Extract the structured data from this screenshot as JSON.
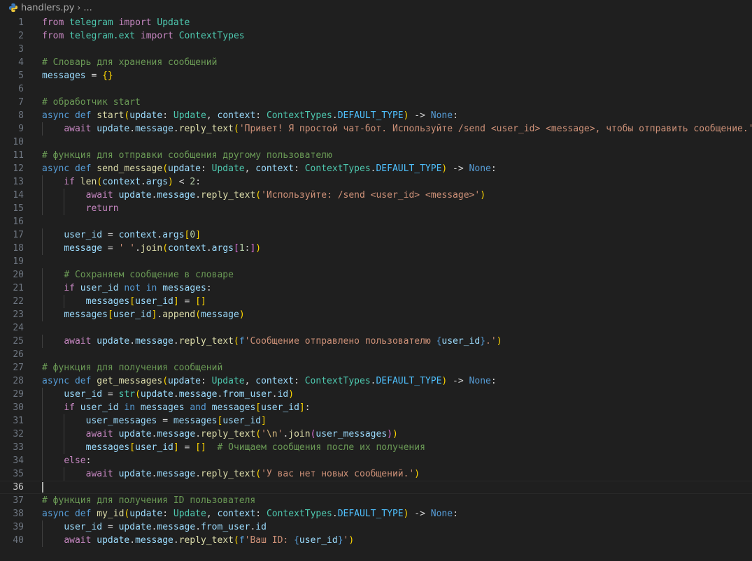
{
  "breadcrumb": {
    "file": "handlers.py",
    "more": "..."
  },
  "editor": {
    "current_line": 36,
    "lines": [
      {
        "n": "1"
      },
      {
        "n": "2"
      },
      {
        "n": "3"
      },
      {
        "n": "4"
      },
      {
        "n": "5"
      },
      {
        "n": "6"
      },
      {
        "n": "7"
      },
      {
        "n": "8"
      },
      {
        "n": "9"
      },
      {
        "n": "10"
      },
      {
        "n": "11"
      },
      {
        "n": "12"
      },
      {
        "n": "13"
      },
      {
        "n": "14"
      },
      {
        "n": "15"
      },
      {
        "n": "16"
      },
      {
        "n": "17"
      },
      {
        "n": "18"
      },
      {
        "n": "19"
      },
      {
        "n": "20"
      },
      {
        "n": "21"
      },
      {
        "n": "22"
      },
      {
        "n": "23"
      },
      {
        "n": "24"
      },
      {
        "n": "25"
      },
      {
        "n": "26"
      },
      {
        "n": "27"
      },
      {
        "n": "28"
      },
      {
        "n": "29"
      },
      {
        "n": "30"
      },
      {
        "n": "31"
      },
      {
        "n": "32"
      },
      {
        "n": "33"
      },
      {
        "n": "34"
      },
      {
        "n": "35"
      },
      {
        "n": "36"
      },
      {
        "n": "37"
      },
      {
        "n": "38"
      },
      {
        "n": "39"
      },
      {
        "n": "40"
      }
    ],
    "code": [
      [
        [
          "k",
          "from"
        ],
        [
          "o",
          " "
        ],
        [
          "t",
          "telegram"
        ],
        [
          "o",
          " "
        ],
        [
          "k",
          "import"
        ],
        [
          "o",
          " "
        ],
        [
          "t",
          "Update"
        ]
      ],
      [
        [
          "k",
          "from"
        ],
        [
          "o",
          " "
        ],
        [
          "t",
          "telegram.ext"
        ],
        [
          "o",
          " "
        ],
        [
          "k",
          "import"
        ],
        [
          "o",
          " "
        ],
        [
          "t",
          "ContextTypes"
        ]
      ],
      [],
      [
        [
          "c",
          "# Словарь для хранения сообщений"
        ]
      ],
      [
        [
          "v",
          "messages"
        ],
        [
          "o",
          " = "
        ],
        [
          "b1",
          "{}"
        ]
      ],
      [],
      [
        [
          "c",
          "# обработчик start"
        ]
      ],
      [
        [
          "d",
          "async"
        ],
        [
          "o",
          " "
        ],
        [
          "d",
          "def"
        ],
        [
          "o",
          " "
        ],
        [
          "f",
          "start"
        ],
        [
          "b1",
          "("
        ],
        [
          "v",
          "update"
        ],
        [
          "o",
          ": "
        ],
        [
          "t",
          "Update"
        ],
        [
          "o",
          ", "
        ],
        [
          "v",
          "context"
        ],
        [
          "o",
          ": "
        ],
        [
          "t",
          "ContextTypes"
        ],
        [
          "o",
          "."
        ],
        [
          "cst",
          "DEFAULT_TYPE"
        ],
        [
          "b1",
          ")"
        ],
        [
          "o",
          " -> "
        ],
        [
          "d",
          "None"
        ],
        [
          "o",
          ":"
        ]
      ],
      [
        [
          "o",
          "    "
        ],
        [
          "k",
          "await"
        ],
        [
          "o",
          " "
        ],
        [
          "v",
          "update"
        ],
        [
          "o",
          "."
        ],
        [
          "v",
          "message"
        ],
        [
          "o",
          "."
        ],
        [
          "f",
          "reply_text"
        ],
        [
          "b1",
          "("
        ],
        [
          "s",
          "'Привет! Я простой чат-бот. Используйте /send <user_id> <message>, чтобы отправить сообщение.'"
        ],
        [
          "b1",
          ")"
        ]
      ],
      [],
      [
        [
          "c",
          "# функция для отправки сообщения другому пользователю"
        ]
      ],
      [
        [
          "d",
          "async"
        ],
        [
          "o",
          " "
        ],
        [
          "d",
          "def"
        ],
        [
          "o",
          " "
        ],
        [
          "f",
          "send_message"
        ],
        [
          "b1",
          "("
        ],
        [
          "v",
          "update"
        ],
        [
          "o",
          ": "
        ],
        [
          "t",
          "Update"
        ],
        [
          "o",
          ", "
        ],
        [
          "v",
          "context"
        ],
        [
          "o",
          ": "
        ],
        [
          "t",
          "ContextTypes"
        ],
        [
          "o",
          "."
        ],
        [
          "cst",
          "DEFAULT_TYPE"
        ],
        [
          "b1",
          ")"
        ],
        [
          "o",
          " -> "
        ],
        [
          "d",
          "None"
        ],
        [
          "o",
          ":"
        ]
      ],
      [
        [
          "o",
          "    "
        ],
        [
          "k",
          "if"
        ],
        [
          "o",
          " "
        ],
        [
          "f",
          "len"
        ],
        [
          "b1",
          "("
        ],
        [
          "v",
          "context"
        ],
        [
          "o",
          "."
        ],
        [
          "v",
          "args"
        ],
        [
          "b1",
          ")"
        ],
        [
          "o",
          " < "
        ],
        [
          "n",
          "2"
        ],
        [
          "o",
          ":"
        ]
      ],
      [
        [
          "o",
          "        "
        ],
        [
          "k",
          "await"
        ],
        [
          "o",
          " "
        ],
        [
          "v",
          "update"
        ],
        [
          "o",
          "."
        ],
        [
          "v",
          "message"
        ],
        [
          "o",
          "."
        ],
        [
          "f",
          "reply_text"
        ],
        [
          "b1",
          "("
        ],
        [
          "s",
          "'Используйте: /send <user_id> <message>'"
        ],
        [
          "b1",
          ")"
        ]
      ],
      [
        [
          "o",
          "        "
        ],
        [
          "k",
          "return"
        ]
      ],
      [],
      [
        [
          "o",
          "    "
        ],
        [
          "v",
          "user_id"
        ],
        [
          "o",
          " = "
        ],
        [
          "v",
          "context"
        ],
        [
          "o",
          "."
        ],
        [
          "v",
          "args"
        ],
        [
          "b1",
          "["
        ],
        [
          "n",
          "0"
        ],
        [
          "b1",
          "]"
        ]
      ],
      [
        [
          "o",
          "    "
        ],
        [
          "v",
          "message"
        ],
        [
          "o",
          " = "
        ],
        [
          "s",
          "' '"
        ],
        [
          "o",
          "."
        ],
        [
          "f",
          "join"
        ],
        [
          "b1",
          "("
        ],
        [
          "v",
          "context"
        ],
        [
          "o",
          "."
        ],
        [
          "v",
          "args"
        ],
        [
          "b2",
          "["
        ],
        [
          "n",
          "1"
        ],
        [
          "o",
          ":"
        ],
        [
          "b2",
          "]"
        ],
        [
          "b1",
          ")"
        ]
      ],
      [],
      [
        [
          "o",
          "    "
        ],
        [
          "c",
          "# Сохраняем сообщение в словаре"
        ]
      ],
      [
        [
          "o",
          "    "
        ],
        [
          "k",
          "if"
        ],
        [
          "o",
          " "
        ],
        [
          "v",
          "user_id"
        ],
        [
          "o",
          " "
        ],
        [
          "d",
          "not in"
        ],
        [
          "o",
          " "
        ],
        [
          "v",
          "messages"
        ],
        [
          "o",
          ":"
        ]
      ],
      [
        [
          "o",
          "        "
        ],
        [
          "v",
          "messages"
        ],
        [
          "b1",
          "["
        ],
        [
          "v",
          "user_id"
        ],
        [
          "b1",
          "]"
        ],
        [
          "o",
          " = "
        ],
        [
          "b1",
          "[]"
        ]
      ],
      [
        [
          "o",
          "    "
        ],
        [
          "v",
          "messages"
        ],
        [
          "b1",
          "["
        ],
        [
          "v",
          "user_id"
        ],
        [
          "b1",
          "]"
        ],
        [
          "o",
          "."
        ],
        [
          "f",
          "append"
        ],
        [
          "b1",
          "("
        ],
        [
          "v",
          "message"
        ],
        [
          "b1",
          ")"
        ]
      ],
      [],
      [
        [
          "o",
          "    "
        ],
        [
          "k",
          "await"
        ],
        [
          "o",
          " "
        ],
        [
          "v",
          "update"
        ],
        [
          "o",
          "."
        ],
        [
          "v",
          "message"
        ],
        [
          "o",
          "."
        ],
        [
          "f",
          "reply_text"
        ],
        [
          "b1",
          "("
        ],
        [
          "d",
          "f"
        ],
        [
          "s",
          "'Сообщение отправлено пользователю "
        ],
        [
          "d",
          "{"
        ],
        [
          "v",
          "user_id"
        ],
        [
          "d",
          "}"
        ],
        [
          "s",
          ".'"
        ],
        [
          "b1",
          ")"
        ]
      ],
      [],
      [
        [
          "c",
          "# функция для получения сообщений"
        ]
      ],
      [
        [
          "d",
          "async"
        ],
        [
          "o",
          " "
        ],
        [
          "d",
          "def"
        ],
        [
          "o",
          " "
        ],
        [
          "f",
          "get_messages"
        ],
        [
          "b1",
          "("
        ],
        [
          "v",
          "update"
        ],
        [
          "o",
          ": "
        ],
        [
          "t",
          "Update"
        ],
        [
          "o",
          ", "
        ],
        [
          "v",
          "context"
        ],
        [
          "o",
          ": "
        ],
        [
          "t",
          "ContextTypes"
        ],
        [
          "o",
          "."
        ],
        [
          "cst",
          "DEFAULT_TYPE"
        ],
        [
          "b1",
          ")"
        ],
        [
          "o",
          " -> "
        ],
        [
          "d",
          "None"
        ],
        [
          "o",
          ":"
        ]
      ],
      [
        [
          "o",
          "    "
        ],
        [
          "v",
          "user_id"
        ],
        [
          "o",
          " = "
        ],
        [
          "t",
          "str"
        ],
        [
          "b1",
          "("
        ],
        [
          "v",
          "update"
        ],
        [
          "o",
          "."
        ],
        [
          "v",
          "message"
        ],
        [
          "o",
          "."
        ],
        [
          "v",
          "from_user"
        ],
        [
          "o",
          "."
        ],
        [
          "v",
          "id"
        ],
        [
          "b1",
          ")"
        ]
      ],
      [
        [
          "o",
          "    "
        ],
        [
          "k",
          "if"
        ],
        [
          "o",
          " "
        ],
        [
          "v",
          "user_id"
        ],
        [
          "o",
          " "
        ],
        [
          "d",
          "in"
        ],
        [
          "o",
          " "
        ],
        [
          "v",
          "messages"
        ],
        [
          "o",
          " "
        ],
        [
          "d",
          "and"
        ],
        [
          "o",
          " "
        ],
        [
          "v",
          "messages"
        ],
        [
          "b1",
          "["
        ],
        [
          "v",
          "user_id"
        ],
        [
          "b1",
          "]"
        ],
        [
          "o",
          ":"
        ]
      ],
      [
        [
          "o",
          "        "
        ],
        [
          "v",
          "user_messages"
        ],
        [
          "o",
          " = "
        ],
        [
          "v",
          "messages"
        ],
        [
          "b1",
          "["
        ],
        [
          "v",
          "user_id"
        ],
        [
          "b1",
          "]"
        ]
      ],
      [
        [
          "o",
          "        "
        ],
        [
          "k",
          "await"
        ],
        [
          "o",
          " "
        ],
        [
          "v",
          "update"
        ],
        [
          "o",
          "."
        ],
        [
          "v",
          "message"
        ],
        [
          "o",
          "."
        ],
        [
          "f",
          "reply_text"
        ],
        [
          "b1",
          "("
        ],
        [
          "s",
          "'"
        ],
        [
          "e",
          "\\n"
        ],
        [
          "s",
          "'"
        ],
        [
          "o",
          "."
        ],
        [
          "f",
          "join"
        ],
        [
          "b2",
          "("
        ],
        [
          "v",
          "user_messages"
        ],
        [
          "b2",
          ")"
        ],
        [
          "b1",
          ")"
        ]
      ],
      [
        [
          "o",
          "        "
        ],
        [
          "v",
          "messages"
        ],
        [
          "b1",
          "["
        ],
        [
          "v",
          "user_id"
        ],
        [
          "b1",
          "]"
        ],
        [
          "o",
          " = "
        ],
        [
          "b1",
          "[]"
        ],
        [
          "o",
          "  "
        ],
        [
          "c",
          "# Очищаем сообщения после их получения"
        ]
      ],
      [
        [
          "o",
          "    "
        ],
        [
          "k",
          "else"
        ],
        [
          "o",
          ":"
        ]
      ],
      [
        [
          "o",
          "        "
        ],
        [
          "k",
          "await"
        ],
        [
          "o",
          " "
        ],
        [
          "v",
          "update"
        ],
        [
          "o",
          "."
        ],
        [
          "v",
          "message"
        ],
        [
          "o",
          "."
        ],
        [
          "f",
          "reply_text"
        ],
        [
          "b1",
          "("
        ],
        [
          "s",
          "'У вас нет новых сообщений.'"
        ],
        [
          "b1",
          ")"
        ]
      ],
      [],
      [
        [
          "c",
          "# функция для получения ID пользователя"
        ]
      ],
      [
        [
          "d",
          "async"
        ],
        [
          "o",
          " "
        ],
        [
          "d",
          "def"
        ],
        [
          "o",
          " "
        ],
        [
          "f",
          "my_id"
        ],
        [
          "b1",
          "("
        ],
        [
          "v",
          "update"
        ],
        [
          "o",
          ": "
        ],
        [
          "t",
          "Update"
        ],
        [
          "o",
          ", "
        ],
        [
          "v",
          "context"
        ],
        [
          "o",
          ": "
        ],
        [
          "t",
          "ContextTypes"
        ],
        [
          "o",
          "."
        ],
        [
          "cst",
          "DEFAULT_TYPE"
        ],
        [
          "b1",
          ")"
        ],
        [
          "o",
          " -> "
        ],
        [
          "d",
          "None"
        ],
        [
          "o",
          ":"
        ]
      ],
      [
        [
          "o",
          "    "
        ],
        [
          "v",
          "user_id"
        ],
        [
          "o",
          " = "
        ],
        [
          "v",
          "update"
        ],
        [
          "o",
          "."
        ],
        [
          "v",
          "message"
        ],
        [
          "o",
          "."
        ],
        [
          "v",
          "from_user"
        ],
        [
          "o",
          "."
        ],
        [
          "v",
          "id"
        ]
      ],
      [
        [
          "o",
          "    "
        ],
        [
          "k",
          "await"
        ],
        [
          "o",
          " "
        ],
        [
          "v",
          "update"
        ],
        [
          "o",
          "."
        ],
        [
          "v",
          "message"
        ],
        [
          "o",
          "."
        ],
        [
          "f",
          "reply_text"
        ],
        [
          "b1",
          "("
        ],
        [
          "d",
          "f"
        ],
        [
          "s",
          "'Ваш ID: "
        ],
        [
          "d",
          "{"
        ],
        [
          "v",
          "user_id"
        ],
        [
          "d",
          "}"
        ],
        [
          "s",
          "'"
        ],
        [
          "b1",
          ")"
        ]
      ]
    ]
  }
}
